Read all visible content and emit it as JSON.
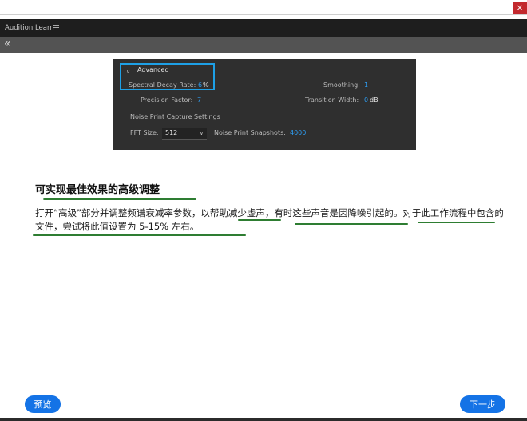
{
  "app": {
    "panel_title": "Audition Learn",
    "close_glyph": "×",
    "back_glyph": "«"
  },
  "screenshot": {
    "section_title": "Advanced",
    "spectral_decay_label": "Spectral Decay Rate:",
    "spectral_decay_value": "6",
    "spectral_decay_unit": "%",
    "smoothing_label": "Smoothing:",
    "smoothing_value": "1",
    "precision_label": "Precision Factor:",
    "precision_value": "7",
    "transition_label": "Transition Width:",
    "transition_value": "0",
    "transition_unit": "dB",
    "capture_settings_label": "Noise Print Capture Settings",
    "fft_label": "FFT Size:",
    "fft_value": "512",
    "snapshots_label": "Noise Print Snapshots:",
    "snapshots_value": "4000"
  },
  "lesson": {
    "heading": "可实现最佳效果的高级调整",
    "body": "打开“高级”部分并调整频谱衰减率参数，以帮助减少虚声，有时这些声音是因降噪引起的。对于此工作流程中包含的文件，尝试将此值设置为 5-15% 左右。"
  },
  "buttons": {
    "preview": "预览",
    "next": "下一步"
  },
  "colors": {
    "accent": "#1473e6",
    "highlight_box": "#1ea0e6",
    "value_blue": "#2d9cf0",
    "underline_green": "#2e7d32"
  }
}
